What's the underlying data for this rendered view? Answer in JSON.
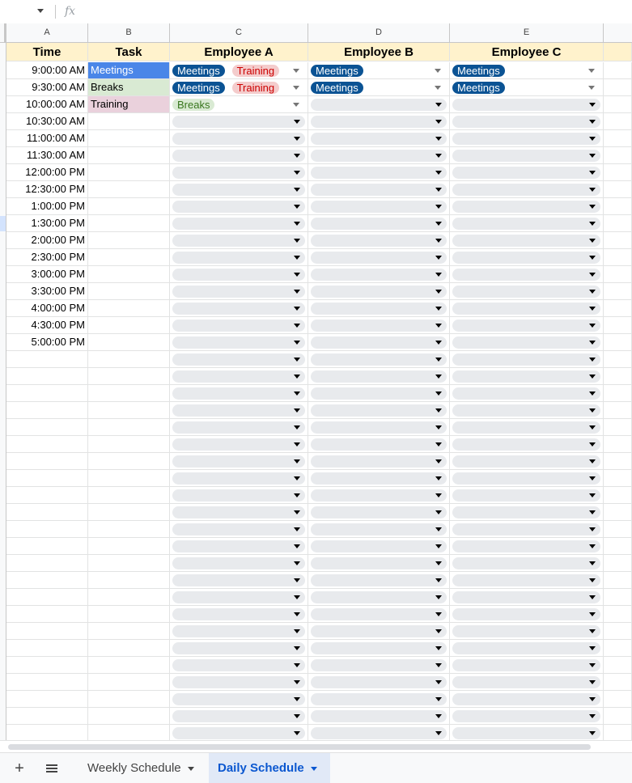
{
  "formula_bar": {
    "fx_label": "fx"
  },
  "columns": [
    "A",
    "B",
    "C",
    "D",
    "E"
  ],
  "headers": {
    "time": "Time",
    "task": "Task",
    "emp_a": "Employee A",
    "emp_b": "Employee B",
    "emp_c": "Employee C"
  },
  "times": [
    "9:00:00 AM",
    "9:30:00 AM",
    "10:00:00 AM",
    "10:30:00 AM",
    "11:00:00 AM",
    "11:30:00 AM",
    "12:00:00 PM",
    "12:30:00 PM",
    "1:00:00 PM",
    "1:30:00 PM",
    "2:00:00 PM",
    "2:30:00 PM",
    "3:00:00 PM",
    "3:30:00 PM",
    "4:00:00 PM",
    "4:30:00 PM",
    "5:00:00 PM"
  ],
  "tasks": [
    "Meetings",
    "Breaks",
    "Training"
  ],
  "assignments": {
    "emp_a": [
      [
        "Meetings",
        "Training"
      ],
      [
        "Meetings",
        "Training"
      ],
      [
        "Breaks"
      ]
    ],
    "emp_b": [
      [
        "Meetings"
      ],
      [
        "Meetings"
      ]
    ],
    "emp_c": [
      [
        "Meetings"
      ],
      [
        "Meetings"
      ]
    ]
  },
  "colors": {
    "meetings": "#0b5394",
    "training_bg": "#f4cccc",
    "training_text": "#cc0000",
    "breaks_bg": "#d9ead3",
    "header_bg": "#fff2cc",
    "task_meetings_bg": "#4a86e8",
    "task_training_bg": "#ead1dc"
  },
  "sheet_tabs": [
    {
      "label": "Weekly Schedule",
      "active": false
    },
    {
      "label": "Daily Schedule",
      "active": true
    }
  ],
  "icons": {
    "add_sheet": "plus-icon",
    "all_sheets": "hamburger-menu-icon"
  }
}
